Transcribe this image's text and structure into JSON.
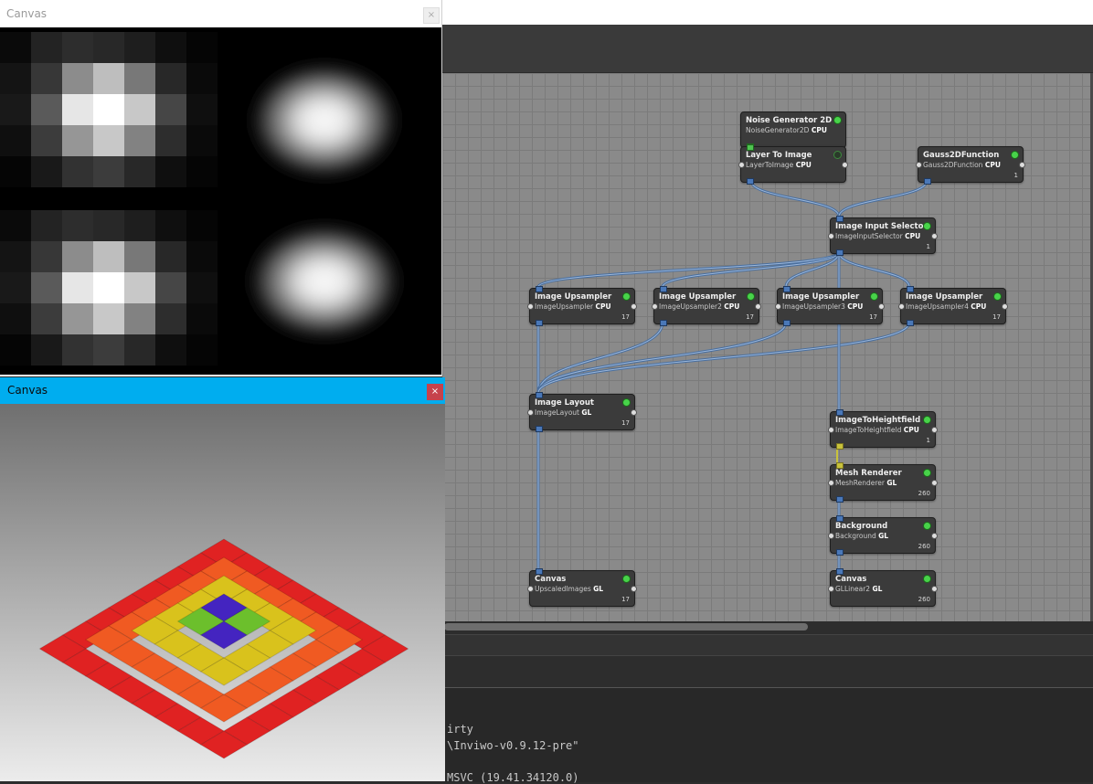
{
  "canvas_top": {
    "title": "Canvas",
    "close_symbol": "×"
  },
  "canvas_bottom": {
    "title": "Canvas",
    "close_symbol": "×"
  },
  "network": {
    "nodes": [
      {
        "id": "noise",
        "title": "Noise Generator 2D",
        "identifier": "NoiseGenerator2D",
        "backend": "CPU",
        "count": ""
      },
      {
        "id": "layer",
        "title": "Layer To Image",
        "identifier": "LayerToImage",
        "backend": "CPU",
        "count": ""
      },
      {
        "id": "gauss",
        "title": "Gauss2DFunction",
        "identifier": "Gauss2DFunction",
        "backend": "CPU",
        "count": "1"
      },
      {
        "id": "selector",
        "title": "Image Input Selector",
        "identifier": "ImageInputSelector",
        "backend": "CPU",
        "count": "1"
      },
      {
        "id": "up1",
        "title": "Image Upsampler",
        "identifier": "ImageUpsampler",
        "backend": "CPU",
        "count": "17"
      },
      {
        "id": "up2",
        "title": "Image Upsampler",
        "identifier": "ImageUpsampler2",
        "backend": "CPU",
        "count": "17"
      },
      {
        "id": "up3",
        "title": "Image Upsampler",
        "identifier": "ImageUpsampler3",
        "backend": "CPU",
        "count": "17"
      },
      {
        "id": "up4",
        "title": "Image Upsampler",
        "identifier": "ImageUpsampler4",
        "backend": "CPU",
        "count": "17"
      },
      {
        "id": "layout",
        "title": "Image Layout",
        "identifier": "ImageLayout",
        "backend": "GL",
        "count": "17"
      },
      {
        "id": "height",
        "title": "ImageToHeightfield",
        "identifier": "ImageToHeightfield",
        "backend": "CPU",
        "count": "1"
      },
      {
        "id": "mesh",
        "title": "Mesh Renderer",
        "identifier": "MeshRenderer",
        "backend": "GL",
        "count": "260"
      },
      {
        "id": "bg",
        "title": "Background",
        "identifier": "Background",
        "backend": "GL",
        "count": "260"
      },
      {
        "id": "canvasA",
        "title": "Canvas",
        "identifier": "UpscaledImages",
        "backend": "GL",
        "count": "17"
      },
      {
        "id": "canvasB",
        "title": "Canvas",
        "identifier": "GLLinear2",
        "backend": "GL",
        "count": "260"
      }
    ]
  },
  "console": {
    "lines": [
      "irty",
      "\\Inviwo-v0.9.12-pre\"",
      "MSVC (19.41.34120.0)"
    ]
  },
  "colors": {
    "network_bg": "#8a8a8a",
    "node_bg": "#3b3b3b",
    "port_image": "#4a78b8",
    "status_on": "#48d34a",
    "active_title": "#00adef",
    "close_red": "#c6424c"
  },
  "icons": {
    "close": "close-icon",
    "status": "status-led-icon"
  }
}
